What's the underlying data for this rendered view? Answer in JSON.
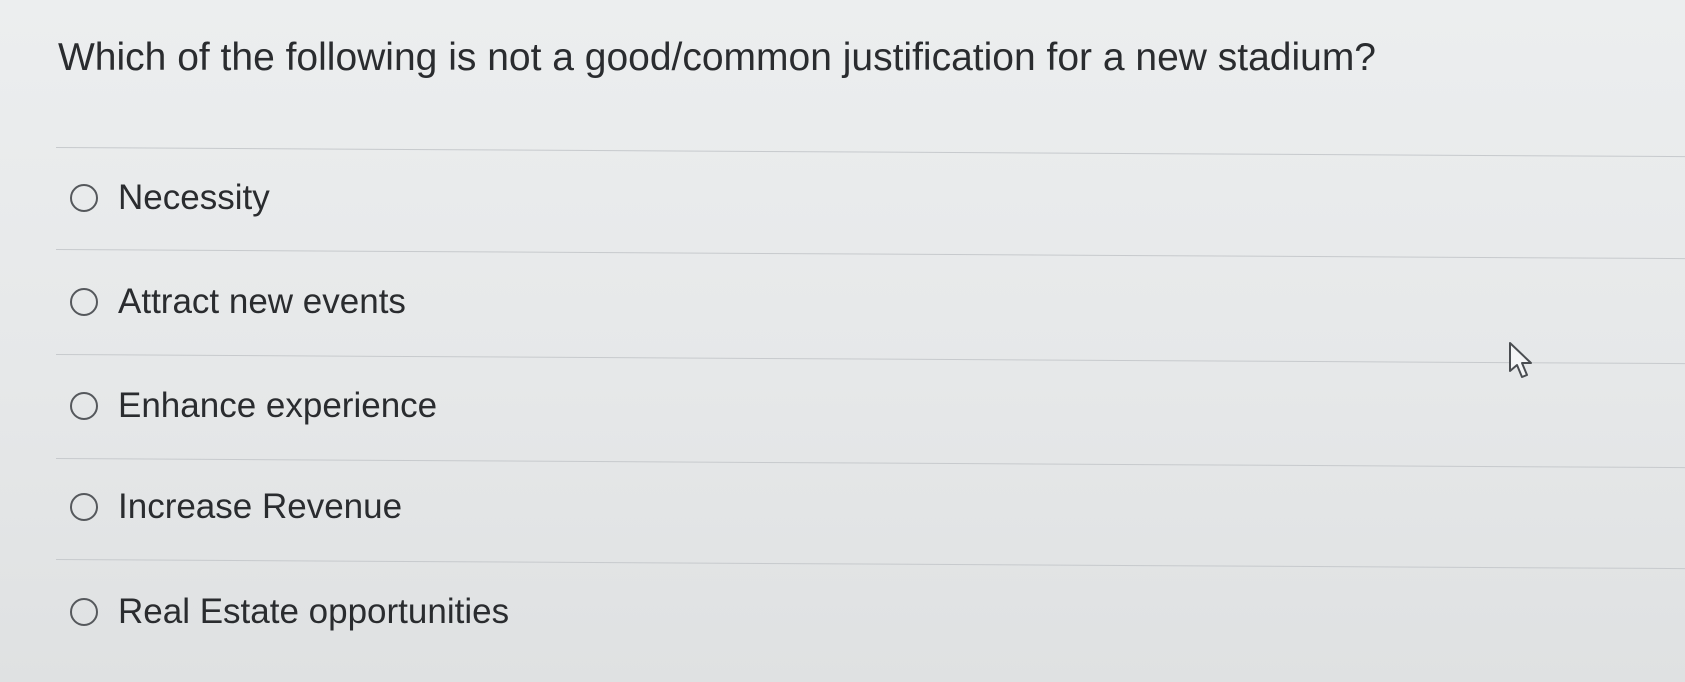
{
  "question": {
    "text": "Which of the following is not a good/common justification for a new stadium?"
  },
  "options": [
    {
      "label": "Necessity",
      "selected": false
    },
    {
      "label": "Attract new events",
      "selected": false
    },
    {
      "label": "Enhance experience",
      "selected": false
    },
    {
      "label": "Increase Revenue",
      "selected": false
    },
    {
      "label": "Real Estate opportunities",
      "selected": false
    }
  ],
  "pointer": {
    "icon": "arrow-cursor-icon"
  }
}
